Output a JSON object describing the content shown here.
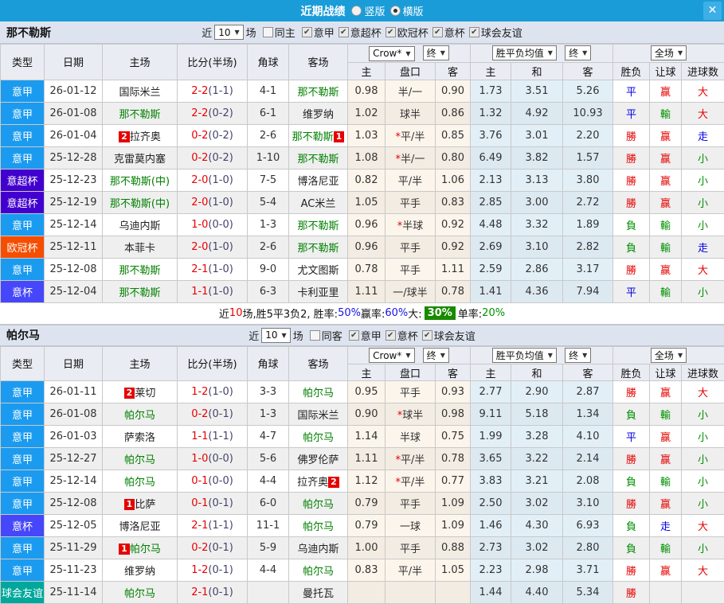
{
  "titlebar": {
    "title": "近期战绩",
    "radio_vertical": "竖版",
    "radio_horizontal": "横版",
    "close": "✕"
  },
  "columns": {
    "type": "类型",
    "date": "日期",
    "home": "主场",
    "score": "比分(半场)",
    "corner": "角球",
    "away": "客场",
    "company_dd": "Crow*",
    "final_dd": "终",
    "europe_dd": "胜平负均值",
    "final2_dd": "终",
    "fulltime_dd": "全场",
    "sub_home": "主",
    "sub_handicap": "盘口",
    "sub_away": "客",
    "sub_ehome": "主",
    "sub_draw": "和",
    "sub_eaway": "客",
    "wdl": "胜负",
    "let_ball": "让球",
    "goals": "进球数"
  },
  "league_colors": {
    "意甲": "#1b9bf0",
    "意超杯": "#4100ce",
    "欧冠杯": "#f54e00",
    "意杯": "#4646fa",
    "球会友谊": "#00a79b"
  },
  "result_colors": {
    "勝": "#e60000",
    "赢": "#e60000",
    "大": "#e60000",
    "負": "#009000",
    "輸": "#009000",
    "小": "#009000",
    "平": "#0000e6",
    "走": "#0000e6"
  },
  "sections": [
    {
      "team": "那不勒斯",
      "filter": {
        "near_label": "近",
        "count": "10",
        "games_label": "场",
        "same_label": "同主",
        "leagues": [
          "意甲",
          "意超杯",
          "欧冠杯",
          "意杯",
          "球会友谊"
        ]
      },
      "rows": [
        {
          "type": "意甲",
          "date": "26-01-12",
          "home": {
            "n": "国际米兰"
          },
          "score": "2-2",
          "half": "(1-1)",
          "corner": "4-1",
          "away": {
            "n": "那不勒斯",
            "g": 1
          },
          "ah": [
            "0.98",
            "半/一",
            "0.90"
          ],
          "eu": [
            "1.73",
            "3.51",
            "5.26"
          ],
          "res": [
            "平",
            "赢",
            "大"
          ]
        },
        {
          "type": "意甲",
          "date": "26-01-08",
          "home": {
            "n": "那不勒斯",
            "g": 1
          },
          "score": "2-2",
          "half": "(0-2)",
          "corner": "6-1",
          "away": {
            "n": "维罗纳"
          },
          "ah": [
            "1.02",
            "球半",
            "0.86"
          ],
          "eu": [
            "1.32",
            "4.92",
            "10.93"
          ],
          "res": [
            "平",
            "輸",
            "大"
          ]
        },
        {
          "type": "意甲",
          "date": "26-01-04",
          "home": {
            "n": "拉齐奥",
            "b": "2"
          },
          "score": "0-2",
          "half": "(0-2)",
          "corner": "2-6",
          "away": {
            "n": "那不勒斯",
            "g": 1,
            "b": "1"
          },
          "ah": [
            "1.03",
            "*平/半",
            "0.85"
          ],
          "eu": [
            "3.76",
            "3.01",
            "2.20"
          ],
          "res": [
            "勝",
            "赢",
            "走"
          ]
        },
        {
          "type": "意甲",
          "date": "25-12-28",
          "home": {
            "n": "克雷莫内塞"
          },
          "score": "0-2",
          "half": "(0-2)",
          "corner": "1-10",
          "away": {
            "n": "那不勒斯",
            "g": 1
          },
          "ah": [
            "1.08",
            "*半/一",
            "0.80"
          ],
          "eu": [
            "6.49",
            "3.82",
            "1.57"
          ],
          "res": [
            "勝",
            "赢",
            "小"
          ]
        },
        {
          "type": "意超杯",
          "date": "25-12-23",
          "home": {
            "n": "那不勒斯(中)",
            "g": 1
          },
          "score": "2-0",
          "half": "(1-0)",
          "corner": "7-5",
          "away": {
            "n": "博洛尼亚"
          },
          "ah": [
            "0.82",
            "平/半",
            "1.06"
          ],
          "eu": [
            "2.13",
            "3.13",
            "3.80"
          ],
          "res": [
            "勝",
            "赢",
            "小"
          ]
        },
        {
          "type": "意超杯",
          "date": "25-12-19",
          "home": {
            "n": "那不勒斯(中)",
            "g": 1
          },
          "score": "2-0",
          "half": "(1-0)",
          "corner": "5-4",
          "away": {
            "n": "AC米兰"
          },
          "ah": [
            "1.05",
            "平手",
            "0.83"
          ],
          "eu": [
            "2.85",
            "3.00",
            "2.72"
          ],
          "res": [
            "勝",
            "赢",
            "小"
          ]
        },
        {
          "type": "意甲",
          "date": "25-12-14",
          "home": {
            "n": "乌迪内斯"
          },
          "score": "1-0",
          "half": "(0-0)",
          "corner": "1-3",
          "away": {
            "n": "那不勒斯",
            "g": 1
          },
          "ah": [
            "0.96",
            "*半球",
            "0.92"
          ],
          "eu": [
            "4.48",
            "3.32",
            "1.89"
          ],
          "res": [
            "負",
            "輸",
            "小"
          ]
        },
        {
          "type": "欧冠杯",
          "date": "25-12-11",
          "home": {
            "n": "本菲卡"
          },
          "score": "2-0",
          "half": "(1-0)",
          "corner": "2-6",
          "away": {
            "n": "那不勒斯",
            "g": 1
          },
          "ah": [
            "0.96",
            "平手",
            "0.92"
          ],
          "eu": [
            "2.69",
            "3.10",
            "2.82"
          ],
          "res": [
            "負",
            "輸",
            "走"
          ]
        },
        {
          "type": "意甲",
          "date": "25-12-08",
          "home": {
            "n": "那不勒斯",
            "g": 1
          },
          "score": "2-1",
          "half": "(1-0)",
          "corner": "9-0",
          "away": {
            "n": "尤文图斯"
          },
          "ah": [
            "0.78",
            "平手",
            "1.11"
          ],
          "eu": [
            "2.59",
            "2.86",
            "3.17"
          ],
          "res": [
            "勝",
            "赢",
            "大"
          ]
        },
        {
          "type": "意杯",
          "date": "25-12-04",
          "home": {
            "n": "那不勒斯",
            "g": 1
          },
          "score": "1-1",
          "half": "(1-0)",
          "corner": "6-3",
          "away": {
            "n": "卡利亚里"
          },
          "ah": [
            "1.11",
            "一/球半",
            "0.78"
          ],
          "eu": [
            "1.41",
            "4.36",
            "7.94"
          ],
          "res": [
            "平",
            "輸",
            "小"
          ]
        }
      ],
      "summary": [
        {
          "t": "近"
        },
        {
          "t": "10",
          "c": "red"
        },
        {
          "t": "场,胜5平3负2, 胜率:"
        },
        {
          "t": "50%",
          "c": "blue"
        },
        {
          "t": " 赢率:"
        },
        {
          "t": "60%",
          "c": "blue"
        },
        {
          "t": " 大:"
        },
        {
          "t": "30%",
          "c": "greenbg"
        },
        {
          "t": " 单率:"
        },
        {
          "t": "20%",
          "c": "green"
        }
      ]
    },
    {
      "team": "帕尔马",
      "filter": {
        "near_label": "近",
        "count": "10",
        "games_label": "场",
        "same_label": "同客",
        "leagues": [
          "意甲",
          "意杯",
          "球会友谊"
        ]
      },
      "rows": [
        {
          "type": "意甲",
          "date": "26-01-11",
          "home": {
            "n": "莱切",
            "b": "2"
          },
          "score": "1-2",
          "half": "(1-0)",
          "corner": "3-3",
          "away": {
            "n": "帕尔马",
            "g": 1
          },
          "ah": [
            "0.95",
            "平手",
            "0.93"
          ],
          "eu": [
            "2.77",
            "2.90",
            "2.87"
          ],
          "res": [
            "勝",
            "赢",
            "大"
          ]
        },
        {
          "type": "意甲",
          "date": "26-01-08",
          "home": {
            "n": "帕尔马",
            "g": 1
          },
          "score": "0-2",
          "half": "(0-1)",
          "corner": "1-3",
          "away": {
            "n": "国际米兰"
          },
          "ah": [
            "0.90",
            "*球半",
            "0.98"
          ],
          "eu": [
            "9.11",
            "5.18",
            "1.34"
          ],
          "res": [
            "負",
            "輸",
            "小"
          ]
        },
        {
          "type": "意甲",
          "date": "26-01-03",
          "home": {
            "n": "萨索洛"
          },
          "score": "1-1",
          "half": "(1-1)",
          "corner": "4-7",
          "away": {
            "n": "帕尔马",
            "g": 1
          },
          "ah": [
            "1.14",
            "半球",
            "0.75"
          ],
          "eu": [
            "1.99",
            "3.28",
            "4.10"
          ],
          "res": [
            "平",
            "赢",
            "小"
          ]
        },
        {
          "type": "意甲",
          "date": "25-12-27",
          "home": {
            "n": "帕尔马",
            "g": 1
          },
          "score": "1-0",
          "half": "(0-0)",
          "corner": "5-6",
          "away": {
            "n": "佛罗伦萨"
          },
          "ah": [
            "1.11",
            "*平/半",
            "0.78"
          ],
          "eu": [
            "3.65",
            "3.22",
            "2.14"
          ],
          "res": [
            "勝",
            "赢",
            "小"
          ]
        },
        {
          "type": "意甲",
          "date": "25-12-14",
          "home": {
            "n": "帕尔马",
            "g": 1
          },
          "score": "0-1",
          "half": "(0-0)",
          "corner": "4-4",
          "away": {
            "n": "拉齐奥",
            "b": "2"
          },
          "ah": [
            "1.12",
            "*平/半",
            "0.77"
          ],
          "eu": [
            "3.83",
            "3.21",
            "2.08"
          ],
          "res": [
            "負",
            "輸",
            "小"
          ]
        },
        {
          "type": "意甲",
          "date": "25-12-08",
          "home": {
            "n": "比萨",
            "b": "1"
          },
          "score": "0-1",
          "half": "(0-1)",
          "corner": "6-0",
          "away": {
            "n": "帕尔马",
            "g": 1
          },
          "ah": [
            "0.79",
            "平手",
            "1.09"
          ],
          "eu": [
            "2.50",
            "3.02",
            "3.10"
          ],
          "res": [
            "勝",
            "赢",
            "小"
          ]
        },
        {
          "type": "意杯",
          "date": "25-12-05",
          "home": {
            "n": "博洛尼亚"
          },
          "score": "2-1",
          "half": "(1-1)",
          "corner": "11-1",
          "away": {
            "n": "帕尔马",
            "g": 1
          },
          "ah": [
            "0.79",
            "一球",
            "1.09"
          ],
          "eu": [
            "1.46",
            "4.30",
            "6.93"
          ],
          "res": [
            "負",
            "走",
            "大"
          ]
        },
        {
          "type": "意甲",
          "date": "25-11-29",
          "home": {
            "n": "帕尔马",
            "g": 1,
            "b": "1"
          },
          "score": "0-2",
          "half": "(0-1)",
          "corner": "5-9",
          "away": {
            "n": "乌迪内斯"
          },
          "ah": [
            "1.00",
            "平手",
            "0.88"
          ],
          "eu": [
            "2.73",
            "3.02",
            "2.80"
          ],
          "res": [
            "負",
            "輸",
            "小"
          ]
        },
        {
          "type": "意甲",
          "date": "25-11-23",
          "home": {
            "n": "维罗纳"
          },
          "score": "1-2",
          "half": "(0-1)",
          "corner": "4-4",
          "away": {
            "n": "帕尔马",
            "g": 1
          },
          "ah": [
            "0.83",
            "平/半",
            "1.05"
          ],
          "eu": [
            "2.23",
            "2.98",
            "3.71"
          ],
          "res": [
            "勝",
            "赢",
            "大"
          ]
        },
        {
          "type": "球会友谊",
          "date": "25-11-14",
          "home": {
            "n": "帕尔马",
            "g": 1
          },
          "score": "2-1",
          "half": "(0-1)",
          "corner": "",
          "away": {
            "n": "曼托瓦"
          },
          "ah": [
            "",
            "",
            ""
          ],
          "eu": [
            "1.44",
            "4.40",
            "5.34"
          ],
          "res": [
            "勝",
            "",
            ""
          ]
        }
      ]
    }
  ]
}
